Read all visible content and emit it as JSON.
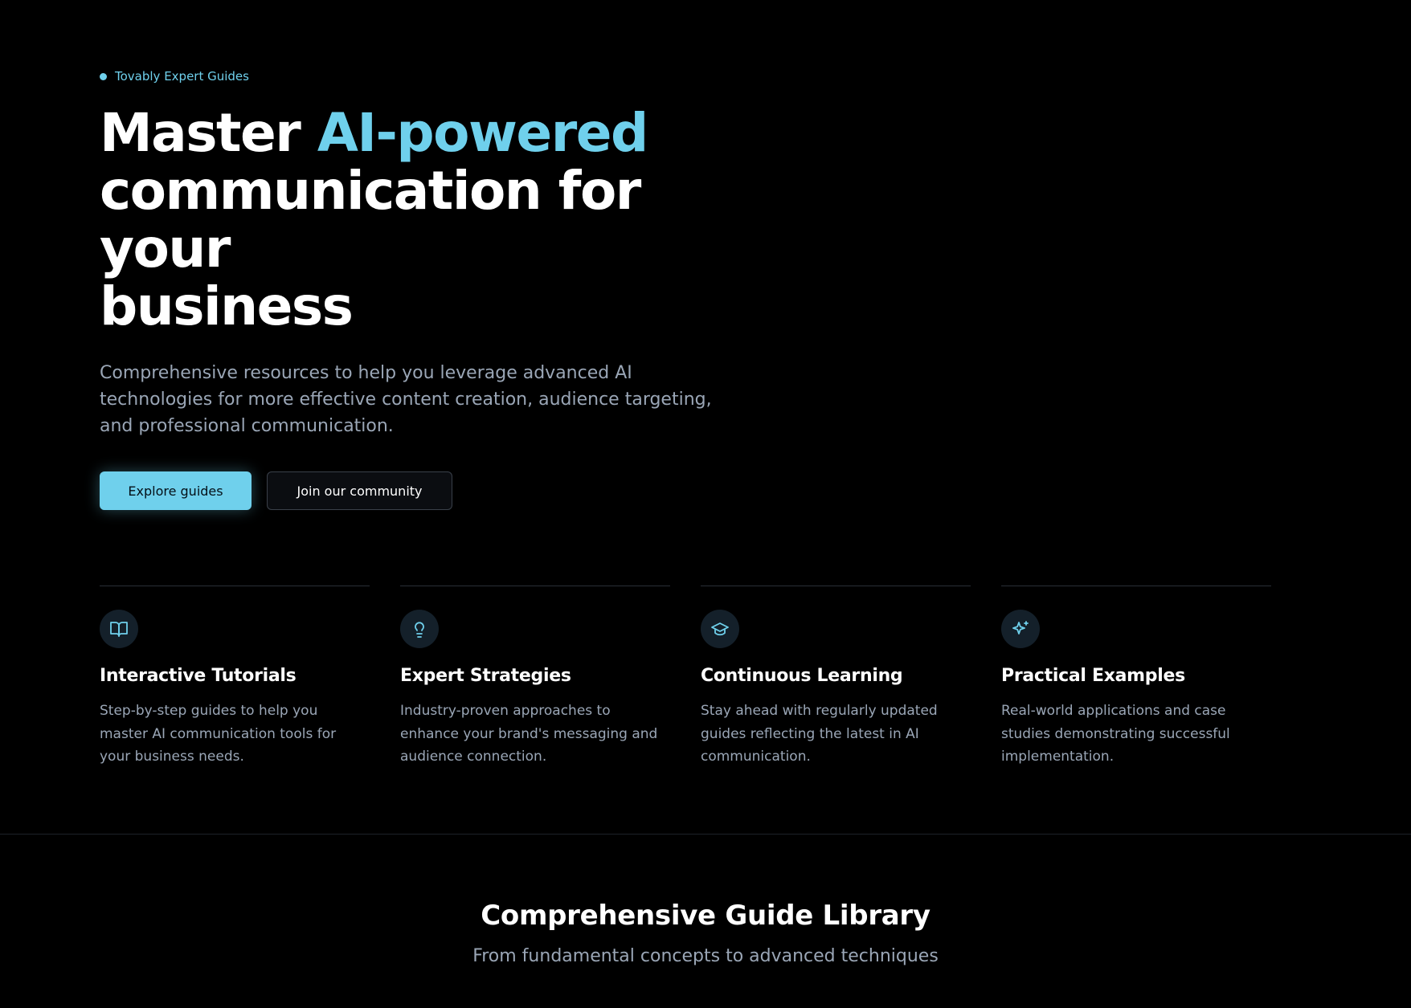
{
  "hero": {
    "eyebrow": "Tovably Expert Guides",
    "headline_prefix": "Master ",
    "headline_accent": "AI-powered",
    "headline_line2": "communication for your",
    "headline_line3": "business",
    "subtitle": "Comprehensive resources to help you leverage advanced AI technologies for more effective content creation, audience targeting, and professional communication.",
    "primary_button": "Explore guides",
    "secondary_button": "Join our community"
  },
  "features": [
    {
      "icon": "book-open-icon",
      "title": "Interactive Tutorials",
      "description": "Step-by-step guides to help you master AI communication tools for your business needs."
    },
    {
      "icon": "lightbulb-icon",
      "title": "Expert Strategies",
      "description": "Industry-proven approaches to enhance your brand's messaging and audience connection."
    },
    {
      "icon": "graduation-cap-icon",
      "title": "Continuous Learning",
      "description": "Stay ahead with regularly updated guides reflecting the latest in AI communication."
    },
    {
      "icon": "sparkles-icon",
      "title": "Practical Examples",
      "description": "Real-world applications and case studies demonstrating successful implementation."
    }
  ],
  "library": {
    "title": "Comprehensive Guide Library",
    "subtitle": "From fundamental concepts to advanced techniques"
  },
  "colors": {
    "background": "#000000",
    "accent": "#6fd0ec",
    "muted_text": "#9aa6b6",
    "icon_bg": "#14202a",
    "divider": "#2a2f37"
  }
}
